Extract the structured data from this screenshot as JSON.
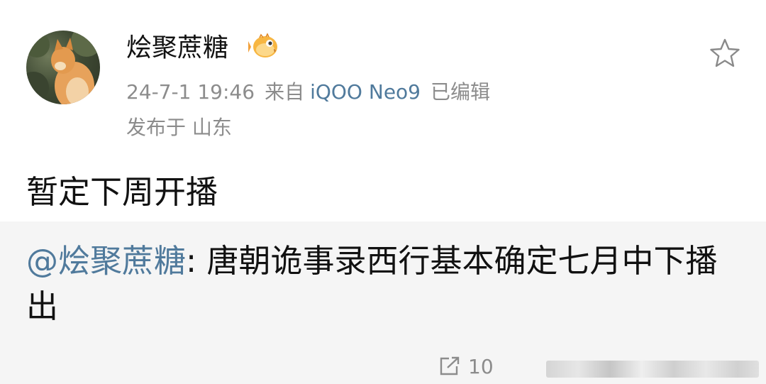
{
  "post": {
    "author": "烩聚蔗糖",
    "timestamp": "24-7-1 19:46",
    "source_prefix": "来自",
    "device": "iQOO Neo9",
    "edited": "已编辑",
    "location": "发布于 山东",
    "text": "暂定下周开播"
  },
  "repost": {
    "mention": "@烩聚蔗糖",
    "text": ": 唐朝诡事录西行基本确定七月中下播出",
    "share_count": "10"
  },
  "icons": {
    "badge": "pufferfish-badge-icon",
    "favorite": "star-icon",
    "share": "share-icon"
  },
  "colors": {
    "link": "#507a9c",
    "secondary_text": "#8c8c8c",
    "repost_background": "#f5f5f5"
  }
}
